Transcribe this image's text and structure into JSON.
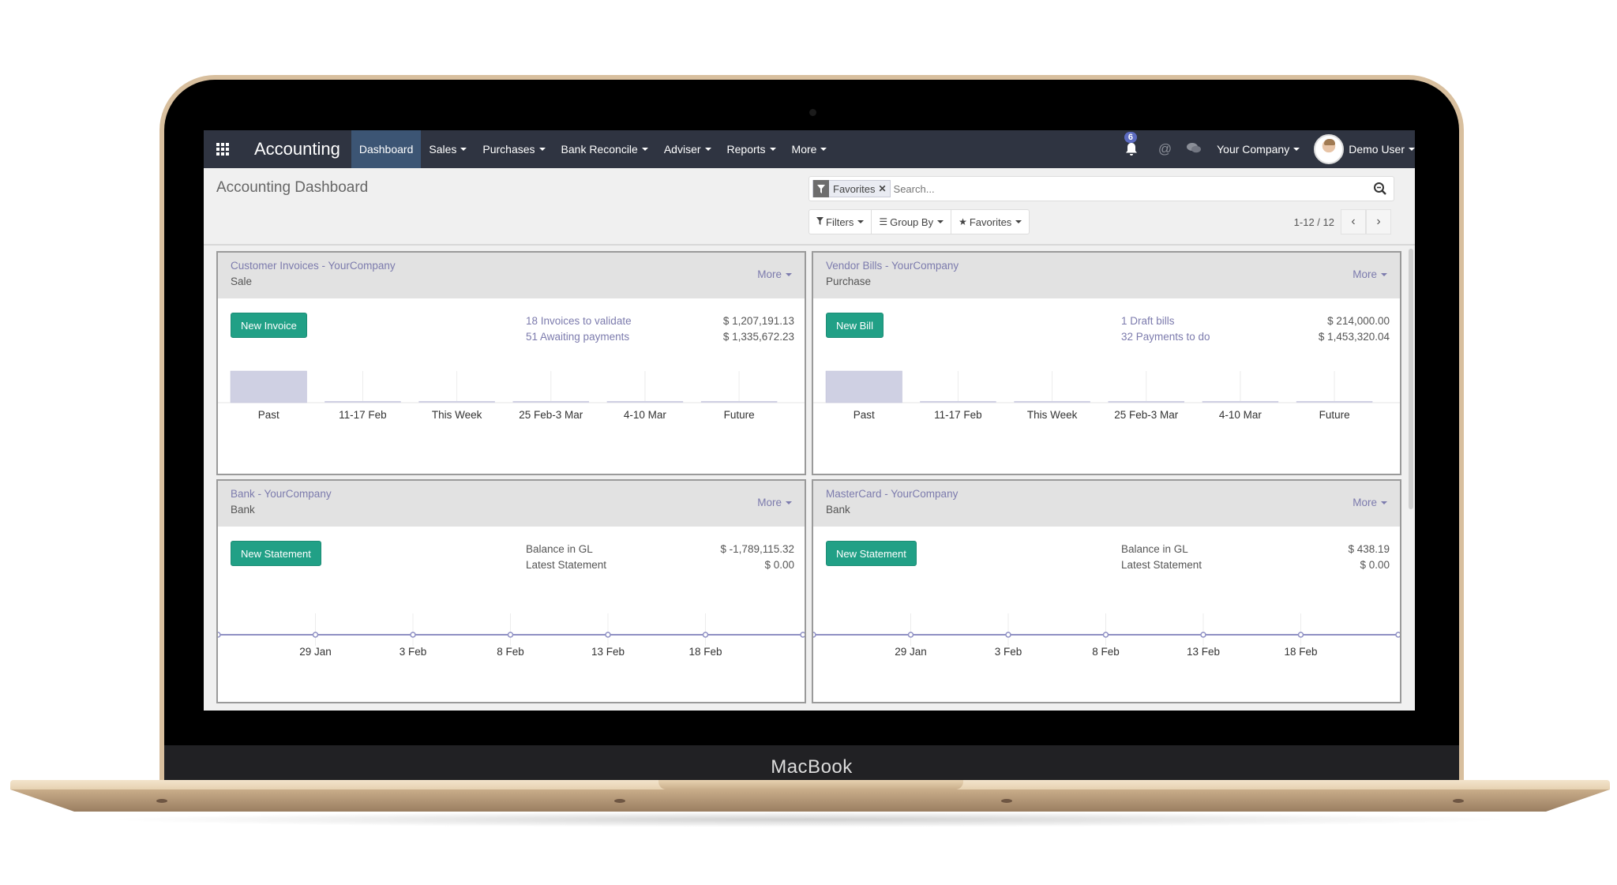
{
  "device": {
    "brand_label": "MacBook"
  },
  "navbar": {
    "app_title": "Accounting",
    "menu": [
      {
        "label": "Dashboard",
        "active": true,
        "dropdown": false
      },
      {
        "label": "Sales",
        "active": false,
        "dropdown": true
      },
      {
        "label": "Purchases",
        "active": false,
        "dropdown": true
      },
      {
        "label": "Bank Reconcile",
        "active": false,
        "dropdown": true
      },
      {
        "label": "Adviser",
        "active": false,
        "dropdown": true
      },
      {
        "label": "Reports",
        "active": false,
        "dropdown": true
      },
      {
        "label": "More",
        "active": false,
        "dropdown": true
      }
    ],
    "notification_count": "6",
    "company": "Your Company",
    "user": "Demo User",
    "icons": [
      "apps-grid-icon",
      "bell-icon",
      "at-sign-icon",
      "chat-bubbles-icon"
    ]
  },
  "control_panel": {
    "breadcrumb": "Accounting Dashboard",
    "search": {
      "facet_label": "Favorites",
      "placeholder": "Search...",
      "value": ""
    },
    "buttons": {
      "filters": "Filters",
      "group_by": "Group By",
      "favorites": "Favorites"
    },
    "pager": {
      "value": "1-12 / 12"
    }
  },
  "colors": {
    "navbar": "#2f3441",
    "active_menu": "#3c5574",
    "primary_button": "#21a086",
    "link": "#7c7bad",
    "graph_fill": "#cfd0e3",
    "graph_line": "#8f90c4"
  },
  "cards": [
    {
      "title": "Customer Invoices - YourCompany",
      "subtitle": "Sale",
      "more_label": "More",
      "button_label": "New Invoice",
      "stats": [
        {
          "label": "18 Invoices to validate",
          "value": "$ 1,207,191.13",
          "link": true
        },
        {
          "label": "51 Awaiting payments",
          "value": "$ 1,335,672.23",
          "link": true
        }
      ]
    },
    {
      "title": "Vendor Bills - YourCompany",
      "subtitle": "Purchase",
      "more_label": "More",
      "button_label": "New Bill",
      "stats": [
        {
          "label": "1 Draft bills",
          "value": "$ 214,000.00",
          "link": true
        },
        {
          "label": "32 Payments to do",
          "value": "$ 1,453,320.04",
          "link": true
        }
      ]
    },
    {
      "title": "Bank - YourCompany",
      "subtitle": "Bank",
      "more_label": "More",
      "button_label": "New Statement",
      "stats": [
        {
          "label": "Balance in GL",
          "value": "$ -1,789,115.32",
          "link": false
        },
        {
          "label": "Latest Statement",
          "value": "$ 0.00",
          "link": false
        }
      ]
    },
    {
      "title": "MasterCard - YourCompany",
      "subtitle": "Bank",
      "more_label": "More",
      "button_label": "New Statement",
      "stats": [
        {
          "label": "Balance in GL",
          "value": "$ 438.19",
          "link": false
        },
        {
          "label": "Latest Statement",
          "value": "$ 0.00",
          "link": false
        }
      ]
    }
  ],
  "chart_data": [
    {
      "type": "bar",
      "title": "Customer Invoices - YourCompany",
      "categories": [
        "Past",
        "11-17 Feb",
        "This Week",
        "25 Feb-3 Mar",
        "4-10 Mar",
        "Future"
      ],
      "values": [
        1,
        0,
        0,
        0,
        0,
        0
      ],
      "xlabel": "",
      "ylabel": "",
      "ylim": [
        0,
        1
      ],
      "grid": true,
      "legend": "none"
    },
    {
      "type": "bar",
      "title": "Vendor Bills - YourCompany",
      "categories": [
        "Past",
        "11-17 Feb",
        "This Week",
        "25 Feb-3 Mar",
        "4-10 Mar",
        "Future"
      ],
      "values": [
        1,
        0,
        0,
        0,
        0,
        0
      ],
      "xlabel": "",
      "ylabel": "",
      "ylim": [
        0,
        1
      ],
      "grid": true,
      "legend": "none"
    },
    {
      "type": "line",
      "title": "Bank - YourCompany",
      "x_ticks": [
        "29 Jan",
        "3 Feb",
        "8 Feb",
        "13 Feb",
        "18 Feb"
      ],
      "points": 7,
      "values": [
        0,
        0,
        0,
        0,
        0,
        0,
        0
      ],
      "xlabel": "",
      "ylabel": "",
      "grid": true,
      "legend": "none"
    },
    {
      "type": "line",
      "title": "MasterCard - YourCompany",
      "x_ticks": [
        "29 Jan",
        "3 Feb",
        "8 Feb",
        "13 Feb",
        "18 Feb"
      ],
      "points": 7,
      "values": [
        0,
        0,
        0,
        0,
        0,
        0,
        0
      ],
      "xlabel": "",
      "ylabel": "",
      "grid": true,
      "legend": "none"
    }
  ]
}
